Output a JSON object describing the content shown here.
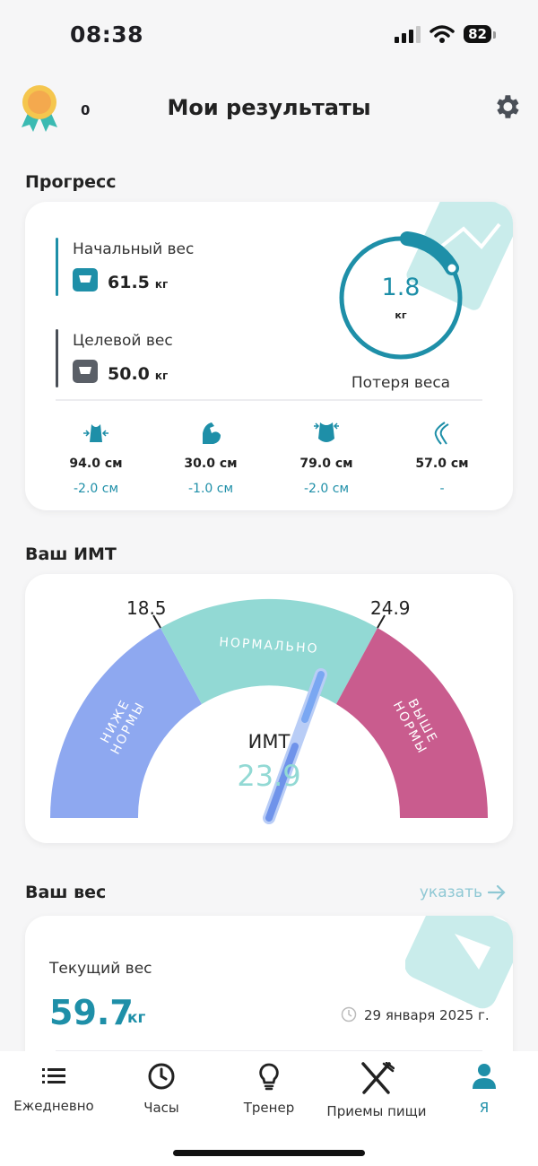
{
  "status": {
    "time": "08:38",
    "battery": "82"
  },
  "header": {
    "award_count": "0",
    "title": "Мои результаты"
  },
  "progress": {
    "title": "Прогресс",
    "start": {
      "label": "Начальный вес",
      "value": "61.5",
      "unit": "кг"
    },
    "target": {
      "label": "Целевой вес",
      "value": "50.0",
      "unit": "кг"
    },
    "loss": {
      "value": "1.8",
      "unit": "кг",
      "caption": "Потеря веса"
    },
    "measurements": [
      {
        "icon": "waist-icon",
        "value": "94.0 см",
        "diff": "-2.0 см"
      },
      {
        "icon": "bicep-icon",
        "value": "30.0 см",
        "diff": "-1.0 см"
      },
      {
        "icon": "hips-icon",
        "value": "79.0 см",
        "diff": "-2.0 см"
      },
      {
        "icon": "thigh-icon",
        "value": "57.0 см",
        "diff": "-"
      }
    ]
  },
  "bmi": {
    "title": "Ваш ИМТ",
    "low_threshold": "18.5",
    "high_threshold": "24.9",
    "zone_below": "НИЖЕ НОРМЫ",
    "zone_normal": "НОРМАЛЬНО",
    "zone_above": "ВЫШЕ НОРМЫ",
    "label": "ИМТ",
    "value": "23.9",
    "colors": {
      "below": "#8ea8f0",
      "normal": "#92d9d4",
      "above": "#c95c8e"
    }
  },
  "weight": {
    "title": "Ваш вес",
    "link": "указать",
    "current_label": "Текущий вес",
    "current_value": "59.7",
    "unit": "кг",
    "date": "29 января 2025 г."
  },
  "tabs": [
    {
      "label": "Ежедневно",
      "icon": "list-icon"
    },
    {
      "label": "Часы",
      "icon": "clock-icon"
    },
    {
      "label": "Тренер",
      "icon": "lightbulb-icon"
    },
    {
      "label": "Приемы пищи",
      "icon": "fork-knife-icon"
    },
    {
      "label": "Я",
      "icon": "person-icon"
    }
  ],
  "accent_color": "#1e8fa8"
}
